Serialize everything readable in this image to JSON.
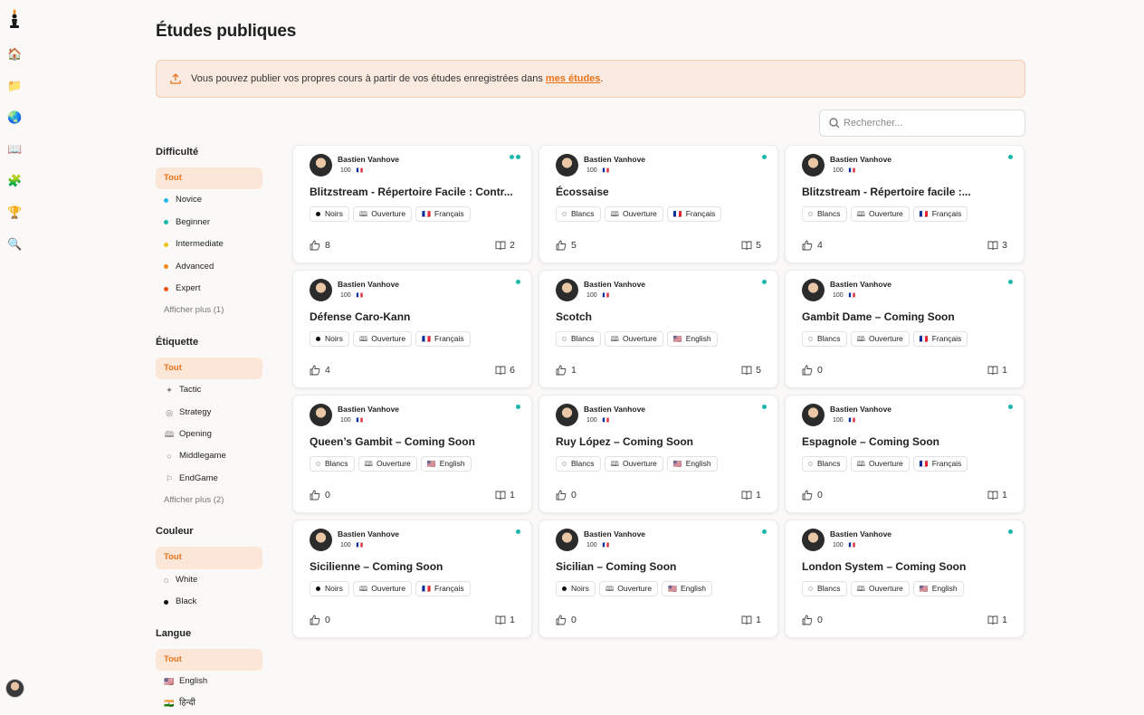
{
  "page": {
    "title": "Études publiques"
  },
  "banner": {
    "text": "Vous pouvez publier vos propres cours à partir de vos études enregistrées dans",
    "link": "mes études",
    "end": "."
  },
  "search": {
    "placeholder": "Rechercher..."
  },
  "nav": [
    "logo-icon",
    "home-icon",
    "folder-icon",
    "globe-icon",
    "book-icon",
    "puzzle-icon",
    "trophy-icon",
    "magnifier-icon"
  ],
  "filters": {
    "difficulte": {
      "title": "Difficulté",
      "all": "Tout",
      "options": [
        {
          "label": "Novice",
          "color": "#22b8e8"
        },
        {
          "label": "Beginner",
          "color": "#18b8ac"
        },
        {
          "label": "Intermediate",
          "color": "#f2c318"
        },
        {
          "label": "Advanced",
          "color": "#f28a18"
        },
        {
          "label": "Expert",
          "color": "#ec5a16"
        }
      ],
      "more": "Afficher plus (1)"
    },
    "etiquette": {
      "title": "Étiquette",
      "all": "Tout",
      "options": [
        {
          "label": "Tactic",
          "icon": "spark-icon"
        },
        {
          "label": "Strategy",
          "icon": "target-icon"
        },
        {
          "label": "Opening",
          "icon": "book-icon"
        },
        {
          "label": "Middlegame",
          "icon": "circle-icon"
        },
        {
          "label": "EndGame",
          "icon": "flag-icon"
        }
      ],
      "more": "Afficher plus (2)"
    },
    "couleur": {
      "title": "Couleur",
      "all": "Tout",
      "options": [
        {
          "label": "White"
        },
        {
          "label": "Black"
        }
      ]
    },
    "langue": {
      "title": "Langue",
      "all": "Tout",
      "options": [
        {
          "label": "English",
          "flag": "🇺🇸"
        },
        {
          "label": "हिन्दी",
          "flag": "🇮🇳"
        }
      ]
    }
  },
  "cards": [
    {
      "author": "Bastien Vanhove",
      "rating": "100",
      "title": "Blitzstream - Répertoire Facile : Contr...",
      "color": "Noirs",
      "colorType": "black",
      "tag": "Ouverture",
      "lang": "Français",
      "langFlag": "🇫🇷",
      "likes": "8",
      "chapters": "2",
      "statusDots": 2
    },
    {
      "author": "Bastien Vanhove",
      "rating": "100",
      "title": "Écossaise",
      "color": "Blancs",
      "colorType": "white",
      "tag": "Ouverture",
      "lang": "Français",
      "langFlag": "🇫🇷",
      "likes": "5",
      "chapters": "5",
      "statusDots": 1
    },
    {
      "author": "Bastien Vanhove",
      "rating": "100",
      "title": "Blitzstream - Répertoire facile :...",
      "color": "Blancs",
      "colorType": "white",
      "tag": "Ouverture",
      "lang": "Français",
      "langFlag": "🇫🇷",
      "likes": "4",
      "chapters": "3",
      "statusDots": 1
    },
    {
      "author": "Bastien Vanhove",
      "rating": "100",
      "title": "Défense Caro-Kann",
      "color": "Noirs",
      "colorType": "black",
      "tag": "Ouverture",
      "lang": "Français",
      "langFlag": "🇫🇷",
      "likes": "4",
      "chapters": "6",
      "statusDots": 1
    },
    {
      "author": "Bastien Vanhove",
      "rating": "100",
      "title": "Scotch",
      "color": "Blancs",
      "colorType": "white",
      "tag": "Ouverture",
      "lang": "English",
      "langFlag": "🇺🇸",
      "likes": "1",
      "chapters": "5",
      "statusDots": 1
    },
    {
      "author": "Bastien Vanhove",
      "rating": "100",
      "title": "Gambit Dame – Coming Soon",
      "color": "Blancs",
      "colorType": "white",
      "tag": "Ouverture",
      "lang": "Français",
      "langFlag": "🇫🇷",
      "likes": "0",
      "chapters": "1",
      "statusDots": 1
    },
    {
      "author": "Bastien Vanhove",
      "rating": "100",
      "title": "Queen’s Gambit – Coming Soon",
      "color": "Blancs",
      "colorType": "white",
      "tag": "Ouverture",
      "lang": "English",
      "langFlag": "🇺🇸",
      "likes": "0",
      "chapters": "1",
      "statusDots": 1
    },
    {
      "author": "Bastien Vanhove",
      "rating": "100",
      "title": "Ruy López – Coming Soon",
      "color": "Blancs",
      "colorType": "white",
      "tag": "Ouverture",
      "lang": "English",
      "langFlag": "🇺🇸",
      "likes": "0",
      "chapters": "1",
      "statusDots": 1
    },
    {
      "author": "Bastien Vanhove",
      "rating": "100",
      "title": "Espagnole – Coming Soon",
      "color": "Blancs",
      "colorType": "white",
      "tag": "Ouverture",
      "lang": "Français",
      "langFlag": "🇫🇷",
      "likes": "0",
      "chapters": "1",
      "statusDots": 1
    },
    {
      "author": "Bastien Vanhove",
      "rating": "100",
      "title": "Sicilienne – Coming Soon",
      "color": "Noirs",
      "colorType": "black",
      "tag": "Ouverture",
      "lang": "Français",
      "langFlag": "🇫🇷",
      "likes": "0",
      "chapters": "1",
      "statusDots": 1
    },
    {
      "author": "Bastien Vanhove",
      "rating": "100",
      "title": "Sicilian – Coming Soon",
      "color": "Noirs",
      "colorType": "black",
      "tag": "Ouverture",
      "lang": "English",
      "langFlag": "🇺🇸",
      "likes": "0",
      "chapters": "1",
      "statusDots": 1
    },
    {
      "author": "Bastien Vanhove",
      "rating": "100",
      "title": "London System – Coming Soon",
      "color": "Blancs",
      "colorType": "white",
      "tag": "Ouverture",
      "lang": "English",
      "langFlag": "🇺🇸",
      "likes": "0",
      "chapters": "1",
      "statusDots": 1
    }
  ]
}
